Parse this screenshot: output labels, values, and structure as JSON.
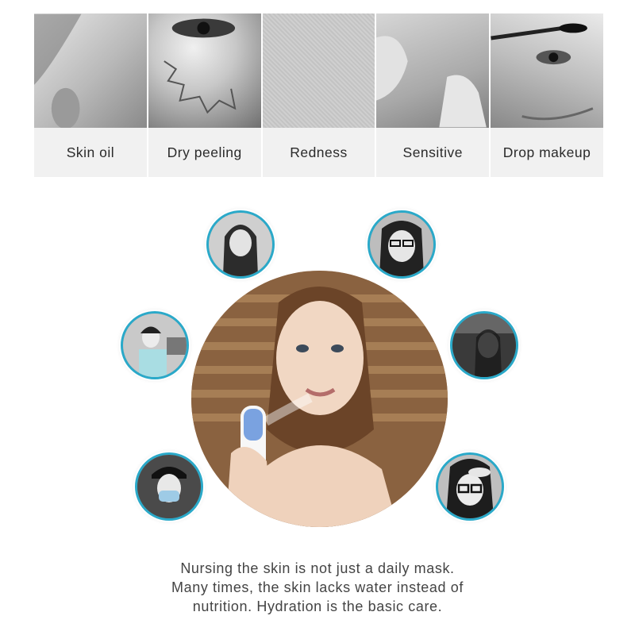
{
  "skin_problems": [
    {
      "label": "Skin oil",
      "icon": "oily-skin-photo"
    },
    {
      "label": "Dry peeling",
      "icon": "dry-peeling-skin-photo"
    },
    {
      "label": "Redness",
      "icon": "redness-skin-photo"
    },
    {
      "label": "Sensitive",
      "icon": "sensitive-skin-photo"
    },
    {
      "label": "Drop makeup",
      "icon": "makeup-mascara-photo"
    }
  ],
  "hero": {
    "icon": "woman-using-face-mist-sprayer-photo"
  },
  "scenario_thumbnails": [
    {
      "icon": "woman-portrait-photo"
    },
    {
      "icon": "woman-with-glasses-hands-on-face-photo"
    },
    {
      "icon": "woman-at-computer-desk-photo"
    },
    {
      "icon": "woman-on-phone-photo"
    },
    {
      "icon": "woman-wearing-face-mask-cap-photo"
    },
    {
      "icon": "woman-with-glasses-touching-forehead-photo"
    }
  ],
  "caption": {
    "line1": "Nursing the skin is not just a daily mask.",
    "line2": "Many times, the skin lacks water instead of",
    "line3": "nutrition. Hydration is the basic care."
  },
  "colors": {
    "accent_ring": "#2aa9c9",
    "label_bg": "#f1f1f1",
    "text": "#444444"
  }
}
